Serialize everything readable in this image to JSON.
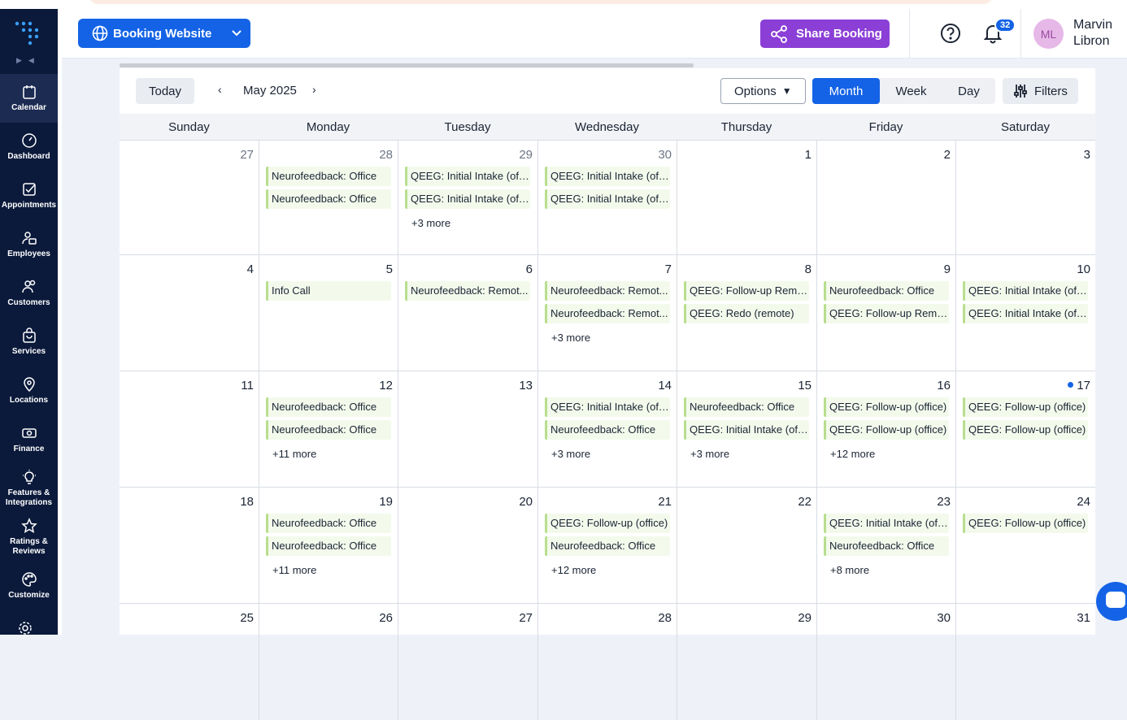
{
  "header": {
    "booking_website_label": "Booking Website",
    "share_booking_label": "Share Booking",
    "notification_count": "32",
    "avatar_initials": "ML",
    "user_first": "Marvin",
    "user_last": "Libron"
  },
  "sidebar": {
    "items": [
      {
        "label": "Calendar",
        "icon": "calendar-icon",
        "active": true
      },
      {
        "label": "Dashboard",
        "icon": "gauge-icon"
      },
      {
        "label": "Appointments",
        "icon": "checkbox-icon"
      },
      {
        "label": "Employees",
        "icon": "employee-icon"
      },
      {
        "label": "Customers",
        "icon": "users-icon"
      },
      {
        "label": "Services",
        "icon": "bag-icon"
      },
      {
        "label": "Locations",
        "icon": "pin-icon"
      },
      {
        "label": "Finance",
        "icon": "money-icon"
      },
      {
        "label": "Features & Integrations",
        "icon": "bulb-icon"
      },
      {
        "label": "Ratings & Reviews",
        "icon": "star-icon"
      },
      {
        "label": "Customize",
        "icon": "palette-icon"
      }
    ]
  },
  "toolbar": {
    "today_label": "Today",
    "month_label": "May 2025",
    "options_label": "Options",
    "views": [
      "Month",
      "Week",
      "Day"
    ],
    "active_view": "Month",
    "filters_label": "Filters"
  },
  "calendar": {
    "weekdays": [
      "Sunday",
      "Monday",
      "Tuesday",
      "Wednesday",
      "Thursday",
      "Friday",
      "Saturday"
    ],
    "weeks": [
      [
        {
          "day": "27",
          "other": true,
          "events": [],
          "more": ""
        },
        {
          "day": "28",
          "other": true,
          "events": [
            "Neurofeedback: Office",
            "Neurofeedback: Office"
          ],
          "more": ""
        },
        {
          "day": "29",
          "other": true,
          "events": [
            "QEEG: Initial Intake (off...",
            "QEEG: Initial Intake (off..."
          ],
          "more": "+3 more"
        },
        {
          "day": "30",
          "other": true,
          "events": [
            "QEEG: Initial Intake (off...",
            "QEEG: Initial Intake (off..."
          ],
          "more": ""
        },
        {
          "day": "1",
          "events": [],
          "more": ""
        },
        {
          "day": "2",
          "events": [],
          "more": ""
        },
        {
          "day": "3",
          "events": [],
          "more": ""
        }
      ],
      [
        {
          "day": "4",
          "events": [],
          "more": ""
        },
        {
          "day": "5",
          "events": [
            "Info Call"
          ],
          "more": ""
        },
        {
          "day": "6",
          "events": [
            "Neurofeedback: Remot..."
          ],
          "more": ""
        },
        {
          "day": "7",
          "events": [
            "Neurofeedback: Remot...",
            "Neurofeedback: Remot..."
          ],
          "more": "+3 more"
        },
        {
          "day": "8",
          "events": [
            "QEEG: Follow-up Remo...",
            "QEEG: Redo (remote)"
          ],
          "more": ""
        },
        {
          "day": "9",
          "events": [
            "Neurofeedback: Office",
            "QEEG: Follow-up Remo..."
          ],
          "more": ""
        },
        {
          "day": "10",
          "events": [
            "QEEG: Initial Intake (off...",
            "QEEG: Initial Intake (off..."
          ],
          "more": ""
        }
      ],
      [
        {
          "day": "11",
          "events": [],
          "more": ""
        },
        {
          "day": "12",
          "events": [
            "Neurofeedback: Office",
            "Neurofeedback: Office"
          ],
          "more": "+11 more"
        },
        {
          "day": "13",
          "events": [],
          "more": ""
        },
        {
          "day": "14",
          "events": [
            "QEEG: Initial Intake (off...",
            "Neurofeedback: Office"
          ],
          "more": "+3 more"
        },
        {
          "day": "15",
          "events": [
            "Neurofeedback: Office",
            "QEEG: Initial Intake (off..."
          ],
          "more": "+3 more"
        },
        {
          "day": "16",
          "events": [
            "QEEG: Follow-up (office)",
            "QEEG: Follow-up (office)"
          ],
          "more": "+12 more"
        },
        {
          "day": "17",
          "today": true,
          "events": [
            "QEEG: Follow-up (office)",
            "QEEG: Follow-up (office)"
          ],
          "more": ""
        }
      ],
      [
        {
          "day": "18",
          "events": [],
          "more": ""
        },
        {
          "day": "19",
          "events": [
            "Neurofeedback: Office",
            "Neurofeedback: Office"
          ],
          "more": "+11 more"
        },
        {
          "day": "20",
          "events": [],
          "more": ""
        },
        {
          "day": "21",
          "events": [
            "QEEG: Follow-up (office)",
            "Neurofeedback: Office"
          ],
          "more": "+12 more"
        },
        {
          "day": "22",
          "events": [],
          "more": ""
        },
        {
          "day": "23",
          "events": [
            "QEEG: Initial Intake (off...",
            "Neurofeedback: Office"
          ],
          "more": "+8 more"
        },
        {
          "day": "24",
          "events": [
            "QEEG: Follow-up (office)"
          ],
          "more": ""
        }
      ],
      [
        {
          "day": "25",
          "events": [],
          "more": ""
        },
        {
          "day": "26",
          "events": [],
          "more": ""
        },
        {
          "day": "27",
          "events": [],
          "more": ""
        },
        {
          "day": "28",
          "events": [],
          "more": ""
        },
        {
          "day": "29",
          "events": [],
          "more": ""
        },
        {
          "day": "30",
          "events": [],
          "more": ""
        },
        {
          "day": "31",
          "events": [],
          "more": ""
        }
      ]
    ]
  }
}
